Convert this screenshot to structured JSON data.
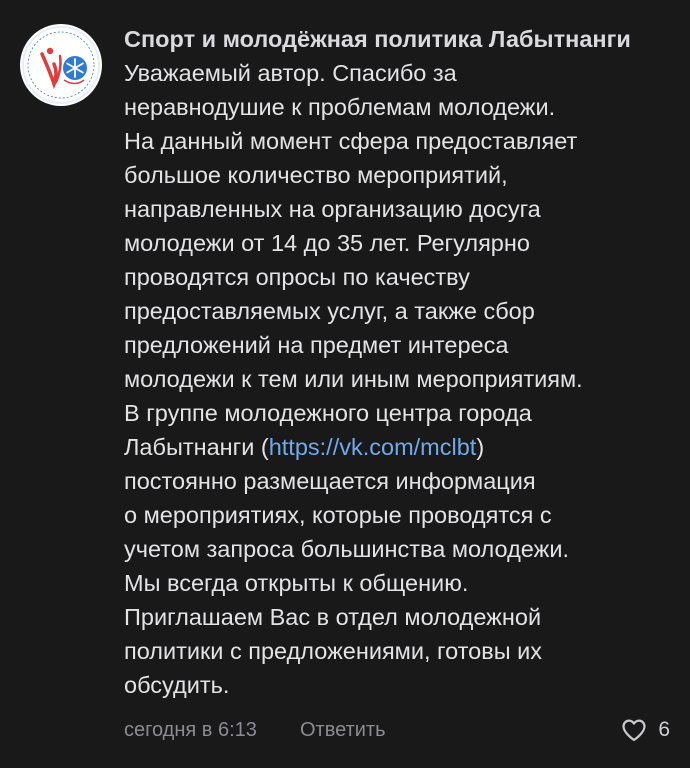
{
  "comment": {
    "avatar_icon": "organization-logo-icon",
    "author": "Спорт и молодёжная политика Лабытнанги",
    "text_lines_before_link": [
      "Уважаемый автор. Спасибо за",
      "неравнодушие к проблемам молодежи.",
      "На данный момент сфера предоставляет",
      "большое количество мероприятий,",
      "направленных на организацию досуга",
      "молодежи от 14 до 35 лет. Регулярно",
      "проводятся опросы по качеству",
      "предоставляемых услуг, а также сбор",
      "предложений на предмет интереса",
      "молодежи к тем или иным мероприятиям.",
      "В группе молодежного центра города"
    ],
    "link_line_prefix": "Лабытнанги (",
    "link_text": "https://vk.com/mclbt",
    "link_line_suffix": ")",
    "text_lines_after_link": [
      "постоянно размещается информация",
      "о мероприятиях, которые проводятся с",
      "учетом запроса большинства молодежи.",
      "Мы всегда открыты к общению.",
      "Приглашаем Вас в отдел молодежной",
      "политики с предложениями, готовы их",
      "обсудить."
    ],
    "timestamp": "сегодня в 6:13",
    "reply_label": "Ответить",
    "like_icon": "heart-outline-icon",
    "like_count": "6"
  },
  "colors": {
    "background": "#19191a",
    "text": "#e3e3e6",
    "link": "#71aaeb",
    "secondary": "#8b8b91"
  }
}
